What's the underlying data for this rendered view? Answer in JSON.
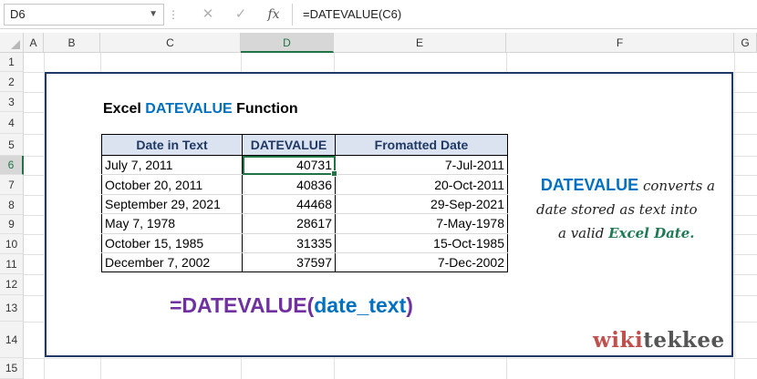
{
  "formula_bar": {
    "name_box": "D6",
    "cancel_glyph": "✕",
    "enter_glyph": "✓",
    "fx_label": "fx",
    "formula": "=DATEVALUE(C6)"
  },
  "columns": [
    "A",
    "B",
    "C",
    "D",
    "E",
    "F",
    "G"
  ],
  "selected_column": "D",
  "rows": [
    "1",
    "2",
    "3",
    "4",
    "5",
    "6",
    "7",
    "8",
    "9",
    "10",
    "11",
    "12",
    "13",
    "14",
    "15"
  ],
  "selected_row": "6",
  "title": {
    "prefix": "Excel ",
    "highlight": "DATEVALUE",
    "suffix": " Function"
  },
  "table": {
    "headers": [
      "Date in Text",
      "DATEVALUE",
      "Fromatted Date"
    ],
    "rows": [
      [
        "July 7, 2011",
        "40731",
        "7-Jul-2011"
      ],
      [
        "October 20, 2011",
        "40836",
        "20-Oct-2011"
      ],
      [
        "September 29, 2021",
        "44468",
        "29-Sep-2021"
      ],
      [
        "May 7, 1978",
        "28617",
        "7-May-1978"
      ],
      [
        "October 15, 1985",
        "31335",
        "15-Oct-1985"
      ],
      [
        "December 7, 2002",
        "37597",
        "7-Dec-2002"
      ]
    ]
  },
  "syntax": {
    "fn": "=DATEVALUE(",
    "arg": "date_text",
    "close": ")"
  },
  "note": {
    "keyword": "DATEVALUE",
    "line1_rest": " converts a",
    "line2": "date stored as text into",
    "line3_prefix": "a valid ",
    "line3_highlight": "Excel Date."
  },
  "logo": {
    "part1": "wiki",
    "part2": "tekkee"
  },
  "colors": {
    "excel_green": "#217346",
    "accent_blue": "#0070c0",
    "purple": "#7030a0",
    "frame_navy": "#1f3864",
    "logo_red": "#c0504d"
  }
}
